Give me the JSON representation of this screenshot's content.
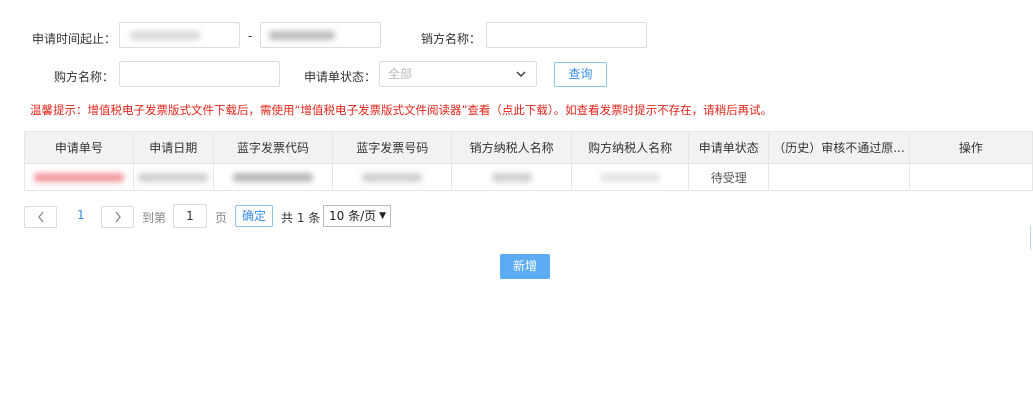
{
  "filters": {
    "apply_time_label": "申请时间起止：",
    "date_separator": "-",
    "seller_name_label": "销方名称：",
    "buyer_name_label": "购方名称：",
    "status_label": "申请单状态：",
    "status_selected": "全部",
    "query_button": "查询"
  },
  "warning_text": "温馨提示：增值税电子发票版式文件下载后，需使用“增值税电子发票版式文件阅读器”查看（点此下载）。如查看发票时提示不存在，请稍后再试。",
  "table": {
    "headers": [
      "申请单号",
      "申请日期",
      "蓝字发票代码",
      "蓝字发票号码",
      "销方纳税人名称",
      "购方纳税人名称",
      "申请单状态",
      "（历史）审核不通过原...",
      "操作"
    ],
    "rows": [
      {
        "status": "待受理"
      }
    ]
  },
  "pagination": {
    "prev": "‹",
    "current_page": "1",
    "next": "›",
    "goto_label": "到第",
    "goto_value": "1",
    "page_unit": "页",
    "confirm": "确定",
    "total": "共 1 条",
    "page_size": "10 条/页"
  },
  "add_button": "新增"
}
